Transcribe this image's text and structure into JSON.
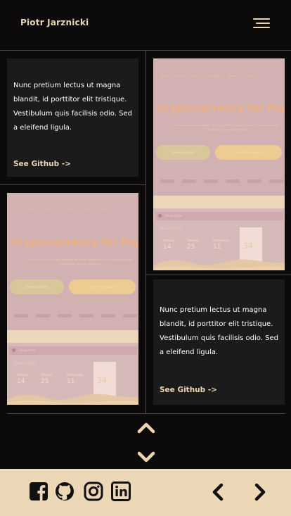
{
  "header": {
    "brand": "Piotr Jarznicki",
    "menu_icon": "hamburger-icon"
  },
  "projects": [
    {
      "description": "Nunc pretium lectus ut magna blandit, id porttitor elit tristique. Vestibulum quis facilisis odio. Sed a eleifend ligula.",
      "link_label": "See Github ->"
    },
    {
      "description": "Nunc pretium lectus ut magna blandit, id porttitor elit tristique. Vestibulum quis facilisis odio. Sed a eleifend ligula.",
      "link_label": "See Github ->"
    }
  ],
  "preview": {
    "nav": [
      "Home",
      "Features",
      "About",
      "Blog Styles",
      "Gallery",
      "Contacts"
    ],
    "title": "Cryptocurrency for Payments",
    "subtitle": "BixCoin is an open source, global payment network that is fully decentralized without any central authorities.",
    "btn_primary": "Download Wallet",
    "btn_secondary": "Get a Free Account",
    "wallet_label": "Edney Orias",
    "activity_label": "Project Activity",
    "stats": [
      {
        "day": "Monday",
        "value": "14"
      },
      {
        "day": "Tuesday",
        "value": "25"
      },
      {
        "day": "Wednesday",
        "value": "11"
      }
    ],
    "highlight_value": "34"
  },
  "controls": {
    "scroll_up_icon": "chevron-up-icon",
    "scroll_down_icon": "chevron-down-icon"
  },
  "footer": {
    "social_icons": [
      "facebook-icon",
      "github-icon",
      "instagram-icon",
      "linkedin-icon"
    ],
    "prev_icon": "chevron-left-icon",
    "next_icon": "chevron-right-icon"
  },
  "colors": {
    "accent": "#ECD6B1",
    "background": "#0C0A0A",
    "card": "#1C1B1B",
    "footer": "#ECD8B6"
  }
}
